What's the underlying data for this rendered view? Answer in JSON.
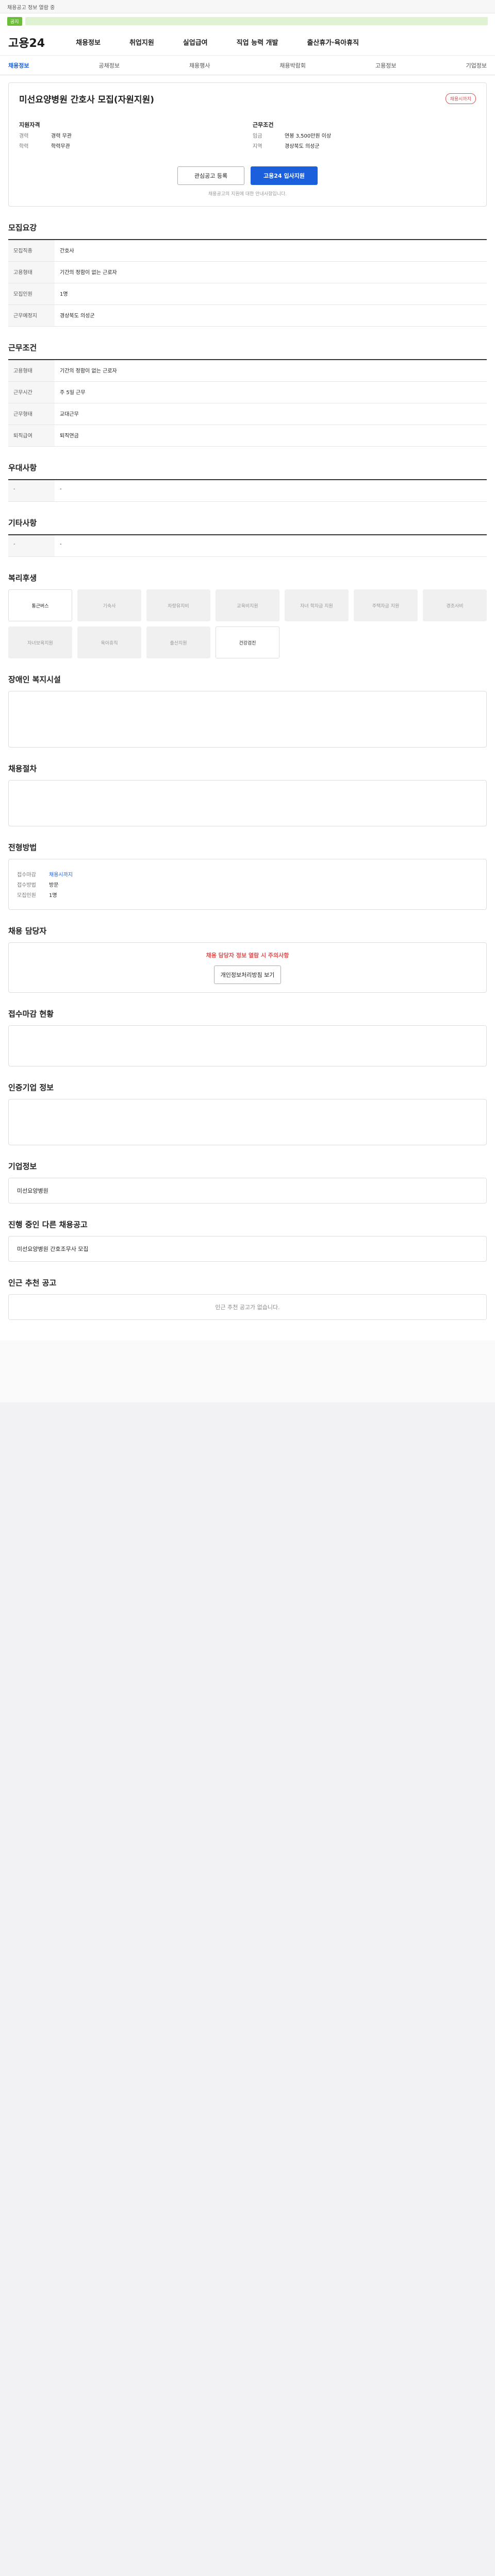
{
  "header": {
    "top_text": "채용공고 정보 열람 중",
    "logo": "고용24",
    "menu": [
      "채용정보",
      "취업지원",
      "실업급여",
      "직업 능력 개발",
      "출산휴가·육아휴직"
    ]
  },
  "subnav": [
    "채용정보",
    "공채정보",
    "채용행사",
    "채용박람회",
    "고용정보",
    "기업정보"
  ],
  "job": {
    "title": "미선요양병원 간호사 모집(자원지원)",
    "badge": "채용시까지"
  },
  "company": {
    "label": "지원자격",
    "rows": [
      {
        "k": "경력",
        "v": "경력 무관"
      },
      {
        "k": "학력",
        "v": "학력무관"
      }
    ]
  },
  "conditions": {
    "label": "근무조건",
    "rows": [
      {
        "k": "임금",
        "v": "연봉 3,500만원 이상"
      },
      {
        "k": "지역",
        "v": "경상북도 의성군"
      }
    ]
  },
  "apply": {
    "scrap": "관심공고 등록",
    "apply": "고용24 입사지원",
    "note": "채용공고의 지원에 대한 안내사항입니다."
  },
  "sections": {
    "s1": "모집요강",
    "s2": "근무조건",
    "s3": "우대사항",
    "s4": "기타사항",
    "s5": "복리후생",
    "s6": "장애인 복지시설",
    "s7": "채용절차",
    "s8": "전형방법",
    "s9": "채용 담당자",
    "s10": "접수마감 현황",
    "s11": "인증기업 정보",
    "s12": "기업정보",
    "s13": "진행 중인 다른 채용공고",
    "s14": "인근 추천 공고"
  },
  "recruit": [
    {
      "k": "모집직종",
      "v": "간호사"
    },
    {
      "k": "고용형태",
      "v": "기간의 정함이 없는 근로자"
    },
    {
      "k": "모집인원",
      "v": "1명"
    },
    {
      "k": "근무예정지",
      "v": "경상북도 의성군"
    }
  ],
  "work": [
    {
      "k": "고용형태",
      "v": "기간의 정함이 없는 근로자"
    },
    {
      "k": "근무시간",
      "v": "주 5일 근무"
    },
    {
      "k": "근무형태",
      "v": "교대근무"
    },
    {
      "k": "퇴직급여",
      "v": "퇴직연금"
    }
  ],
  "welfare": [
    "통근버스",
    "기숙사",
    "차량유지비",
    "교육비지원",
    "자녀 학자금 지원",
    "주택자금 지원",
    "경조사비",
    "자녀보육지원",
    "육아휴직",
    "출산지원",
    "건강검진"
  ],
  "contact": {
    "warning": "채용 담당자 정보 열람 시 주의사항",
    "btn": "개인정보처리방침 보기"
  },
  "deadline": [
    {
      "k": "접수마감",
      "v": "채용시까지"
    },
    {
      "k": "접수방법",
      "v": "방문"
    },
    {
      "k": "모집인원",
      "v": "1명"
    }
  ],
  "others": {
    "company": "미선요양병원",
    "job": "미선요양병원 간호조무사 모집"
  },
  "recommend": "인근 추천 공고가 없습니다."
}
